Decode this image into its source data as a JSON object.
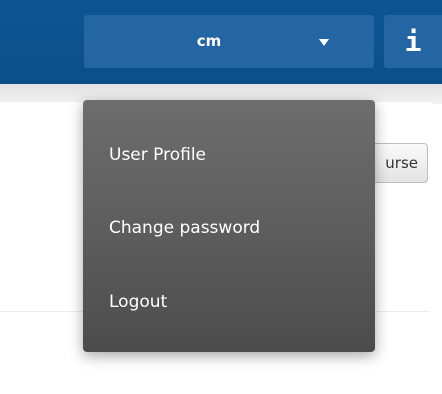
{
  "header": {
    "user_menu": {
      "label": "cm",
      "caret_icon": "caret-down-icon"
    },
    "info_button": {
      "glyph": "i",
      "icon": "info-icon"
    }
  },
  "dropdown": {
    "items": [
      {
        "label": "User Profile"
      },
      {
        "label": "Change password"
      },
      {
        "label": "Logout"
      }
    ]
  },
  "content": {
    "course_button_label": "urse"
  },
  "colors": {
    "header_bg": "#0c5694",
    "header_button_bg": "#2366a3",
    "menu_bg_top": "#6d6d6d",
    "menu_bg_bottom": "#4c4c4c"
  }
}
